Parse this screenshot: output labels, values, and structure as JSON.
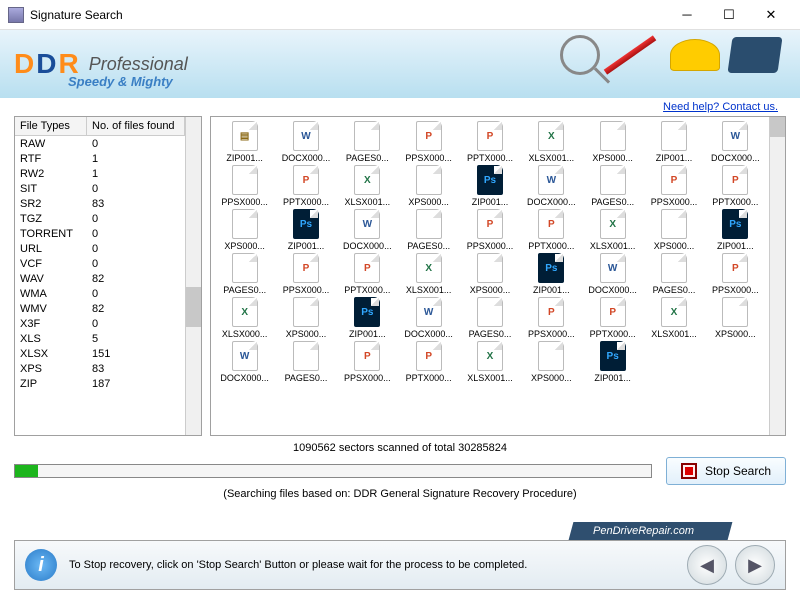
{
  "window": {
    "title": "Signature Search"
  },
  "banner": {
    "logo_ddr": "DDR",
    "subtitle": "Professional",
    "tagline": "Speedy & Mighty"
  },
  "help": {
    "label": "Need help? Contact us."
  },
  "left_table": {
    "col1": "File Types",
    "col2": "No. of files found",
    "rows": [
      {
        "t": "RAW",
        "c": "0"
      },
      {
        "t": "RTF",
        "c": "1"
      },
      {
        "t": "RW2",
        "c": "1"
      },
      {
        "t": "SIT",
        "c": "0"
      },
      {
        "t": "SR2",
        "c": "83"
      },
      {
        "t": "TGZ",
        "c": "0"
      },
      {
        "t": "TORRENT",
        "c": "0"
      },
      {
        "t": "URL",
        "c": "0"
      },
      {
        "t": "VCF",
        "c": "0"
      },
      {
        "t": "WAV",
        "c": "82"
      },
      {
        "t": "WMA",
        "c": "0"
      },
      {
        "t": "WMV",
        "c": "82"
      },
      {
        "t": "X3F",
        "c": "0"
      },
      {
        "t": "XLS",
        "c": "5"
      },
      {
        "t": "XLSX",
        "c": "151"
      },
      {
        "t": "XPS",
        "c": "83"
      },
      {
        "t": "ZIP",
        "c": "187"
      }
    ]
  },
  "grid": {
    "items": [
      {
        "n": "ZIP001...",
        "k": "zip"
      },
      {
        "n": "DOCX000...",
        "k": "doc"
      },
      {
        "n": "PAGES0...",
        "k": ""
      },
      {
        "n": "PPSX000...",
        "k": "ppt"
      },
      {
        "n": "PPTX000...",
        "k": "ppt"
      },
      {
        "n": "XLSX001...",
        "k": "xls"
      },
      {
        "n": "XPS000...",
        "k": ""
      },
      {
        "n": "ZIP001...",
        "k": ""
      },
      {
        "n": "DOCX000...",
        "k": "doc"
      },
      {
        "n": "PPSX000...",
        "k": ""
      },
      {
        "n": "PPTX000...",
        "k": "ppt"
      },
      {
        "n": "XLSX001...",
        "k": "xls"
      },
      {
        "n": "XPS000...",
        "k": ""
      },
      {
        "n": "ZIP001...",
        "k": "ps"
      },
      {
        "n": "DOCX000...",
        "k": "doc"
      },
      {
        "n": "PAGES0...",
        "k": ""
      },
      {
        "n": "PPSX000...",
        "k": "ppt"
      },
      {
        "n": "PPTX000...",
        "k": "ppt"
      },
      {
        "n": "XPS000...",
        "k": ""
      },
      {
        "n": "ZIP001...",
        "k": "ps"
      },
      {
        "n": "DOCX000...",
        "k": "doc"
      },
      {
        "n": "PAGES0...",
        "k": ""
      },
      {
        "n": "PPSX000...",
        "k": "ppt"
      },
      {
        "n": "PPTX000...",
        "k": "ppt"
      },
      {
        "n": "XLSX001...",
        "k": "xls"
      },
      {
        "n": "XPS000...",
        "k": ""
      },
      {
        "n": "ZIP001...",
        "k": "ps"
      },
      {
        "n": "PAGES0...",
        "k": ""
      },
      {
        "n": "PPSX000...",
        "k": "ppt"
      },
      {
        "n": "PPTX000...",
        "k": "ppt"
      },
      {
        "n": "XLSX001...",
        "k": "xls"
      },
      {
        "n": "XPS000...",
        "k": ""
      },
      {
        "n": "ZIP001...",
        "k": "ps"
      },
      {
        "n": "DOCX000...",
        "k": "doc"
      },
      {
        "n": "PAGES0...",
        "k": ""
      },
      {
        "n": "PPSX000...",
        "k": "ppt"
      },
      {
        "n": "XLSX000...",
        "k": "xls"
      },
      {
        "n": "XPS000...",
        "k": ""
      },
      {
        "n": "ZIP001...",
        "k": "ps"
      },
      {
        "n": "DOCX000...",
        "k": "doc"
      },
      {
        "n": "PAGES0...",
        "k": ""
      },
      {
        "n": "PPSX000...",
        "k": "ppt"
      },
      {
        "n": "PPTX000...",
        "k": "ppt"
      },
      {
        "n": "XLSX001...",
        "k": "xls"
      },
      {
        "n": "XPS000...",
        "k": ""
      },
      {
        "n": "DOCX000...",
        "k": "doc"
      },
      {
        "n": "PAGES0...",
        "k": ""
      },
      {
        "n": "PPSX000...",
        "k": "ppt"
      },
      {
        "n": "PPTX000...",
        "k": "ppt"
      },
      {
        "n": "XLSX001...",
        "k": "xls"
      },
      {
        "n": "XPS000...",
        "k": ""
      },
      {
        "n": "ZIP001...",
        "k": "ps"
      }
    ]
  },
  "progress": {
    "status": "1090562 sectors scanned of total 30285824",
    "note": "(Searching files based on:   DDR General Signature Recovery Procedure)",
    "stop_label": "Stop Search"
  },
  "footer": {
    "tip": "To Stop recovery, click on 'Stop Search' Button or please wait for the process to be completed.",
    "brand": "PenDriveRepair.com"
  },
  "icon_glyph": {
    "doc": "W",
    "ppt": "P",
    "xls": "X",
    "ps": "Ps",
    "zip": "▤"
  }
}
